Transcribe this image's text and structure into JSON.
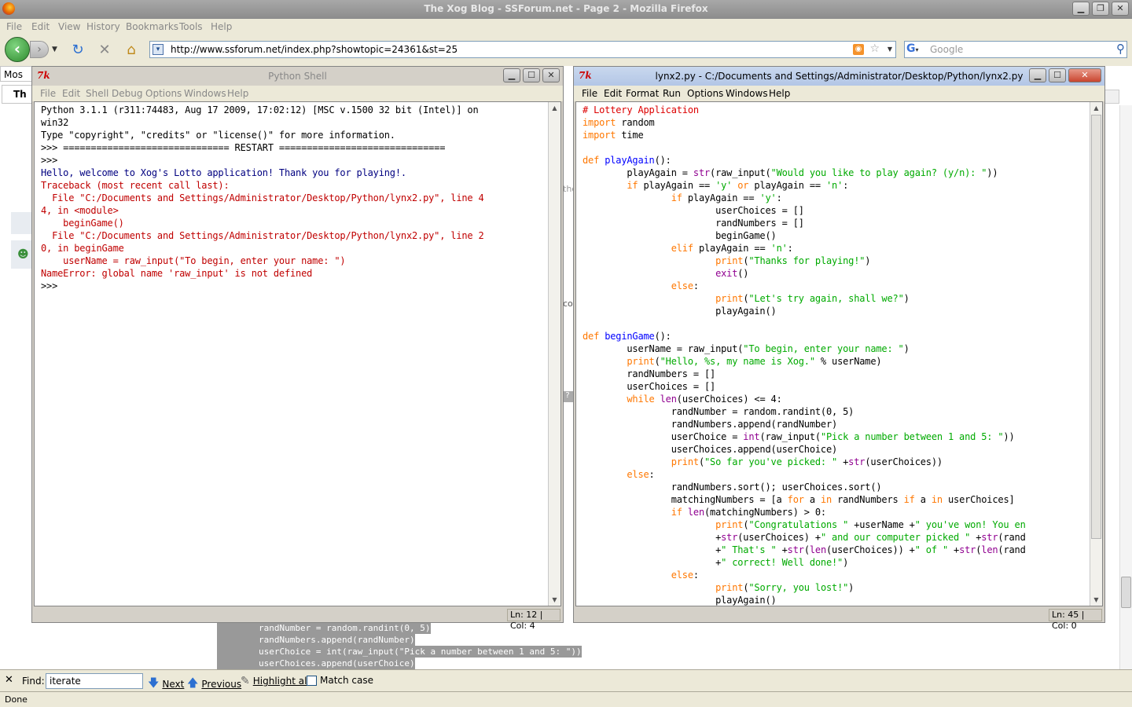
{
  "browser": {
    "title": "The Xog Blog - SSForum.net - Page 2 - Mozilla Firefox",
    "menu": [
      "File",
      "Edit",
      "View",
      "History",
      "Bookmarks",
      "Tools",
      "Help"
    ],
    "url": "http://www.ssforum.net/index.php?showtopic=24361&st=25",
    "search_placeholder": "Google",
    "tab_fragments": [
      "Mos",
      "Th"
    ],
    "status": "Done"
  },
  "find_bar": {
    "label": "Find:",
    "value": "iterate",
    "next": "Next",
    "previous": "Previous",
    "highlight_all": "Highlight all",
    "match_case": "Match case"
  },
  "page_fragments": [
    "the",
    "co",
    "?"
  ],
  "page_code_strip": [
    "        randNumber = random.randint(0, 5)",
    "        randNumbers.append(randNumber)",
    "        userChoice = int(raw_input(\"Pick a number between 1 and 5: \"))",
    "        userChoices.append(userChoice)"
  ],
  "shell": {
    "title": "Python Shell",
    "tk_icon": "7k",
    "menu": [
      "File",
      "Edit",
      "Shell",
      "Debug",
      "Options",
      "Windows",
      "Help"
    ],
    "lines": [
      {
        "cls": "",
        "text": "Python 3.1.1 (r311:74483, Aug 17 2009, 17:02:12) [MSC v.1500 32 bit (Intel)] on"
      },
      {
        "cls": "",
        "text": "win32"
      },
      {
        "cls": "",
        "text": "Type \"copyright\", \"credits\" or \"license()\" for more information."
      },
      {
        "cls": "",
        "text": ">>> ============================== RESTART =============================="
      },
      {
        "cls": "",
        "text": ">>>"
      },
      {
        "cls": "out",
        "text": "Hello, welcome to Xog's Lotto application! Thank you for playing!."
      },
      {
        "cls": "err",
        "text": "Traceback (most recent call last):"
      },
      {
        "cls": "err",
        "text": "  File \"C:/Documents and Settings/Administrator/Desktop/Python/lynx2.py\", line 4"
      },
      {
        "cls": "err",
        "text": "4, in <module>"
      },
      {
        "cls": "err",
        "text": "    beginGame()"
      },
      {
        "cls": "err",
        "text": "  File \"C:/Documents and Settings/Administrator/Desktop/Python/lynx2.py\", line 2"
      },
      {
        "cls": "err",
        "text": "0, in beginGame"
      },
      {
        "cls": "err",
        "text": "    userName = raw_input(\"To begin, enter your name: \")"
      },
      {
        "cls": "err",
        "text": "NameError: global name 'raw_input' is not defined"
      },
      {
        "cls": "",
        "text": ">>>"
      }
    ],
    "status": "Ln: 12 | Col: 4"
  },
  "editor": {
    "title": "lynx2.py - C:/Documents and Settings/Administrator/Desktop/Python/lynx2.py",
    "tk_icon": "7k",
    "menu": [
      "File",
      "Edit",
      "Format",
      "Run",
      "Options",
      "Windows",
      "Help"
    ],
    "lines": [
      [
        [
          "c",
          "# Lottery Application"
        ]
      ],
      [
        [
          "k",
          "import"
        ],
        [
          "",
          " random"
        ]
      ],
      [
        [
          "k",
          "import"
        ],
        [
          "",
          " time"
        ]
      ],
      [
        [
          "",
          ""
        ]
      ],
      [
        [
          "k",
          "def"
        ],
        [
          "",
          " "
        ],
        [
          "d",
          "playAgain"
        ],
        [
          "",
          "():"
        ]
      ],
      [
        [
          "",
          "        playAgain = "
        ],
        [
          "b",
          "str"
        ],
        [
          "",
          "(raw_input("
        ],
        [
          "s",
          "\"Would you like to play again? (y/n): \""
        ],
        [
          "",
          "))"
        ]
      ],
      [
        [
          "",
          "        "
        ],
        [
          "k",
          "if"
        ],
        [
          "",
          " playAgain == "
        ],
        [
          "s",
          "'y'"
        ],
        [
          "",
          " "
        ],
        [
          "k",
          "or"
        ],
        [
          "",
          " playAgain == "
        ],
        [
          "s",
          "'n'"
        ],
        [
          "",
          ":"
        ]
      ],
      [
        [
          "",
          "                "
        ],
        [
          "k",
          "if"
        ],
        [
          "",
          " playAgain == "
        ],
        [
          "s",
          "'y'"
        ],
        [
          "",
          ":"
        ]
      ],
      [
        [
          "",
          "                        userChoices = []"
        ]
      ],
      [
        [
          "",
          "                        randNumbers = []"
        ]
      ],
      [
        [
          "",
          "                        beginGame()"
        ]
      ],
      [
        [
          "",
          "                "
        ],
        [
          "k",
          "elif"
        ],
        [
          "",
          " playAgain == "
        ],
        [
          "s",
          "'n'"
        ],
        [
          "",
          ":"
        ]
      ],
      [
        [
          "",
          "                        "
        ],
        [
          "k",
          "print"
        ],
        [
          "",
          "("
        ],
        [
          "s",
          "\"Thanks for playing!\""
        ],
        [
          "",
          ")"
        ]
      ],
      [
        [
          "",
          "                        "
        ],
        [
          "b",
          "exit"
        ],
        [
          "",
          "()"
        ]
      ],
      [
        [
          "",
          "                "
        ],
        [
          "k",
          "else"
        ],
        [
          "",
          ":"
        ]
      ],
      [
        [
          "",
          "                        "
        ],
        [
          "k",
          "print"
        ],
        [
          "",
          "("
        ],
        [
          "s",
          "\"Let's try again, shall we?\""
        ],
        [
          "",
          ")"
        ]
      ],
      [
        [
          "",
          "                        playAgain()"
        ]
      ],
      [
        [
          "",
          ""
        ]
      ],
      [
        [
          "k",
          "def"
        ],
        [
          "",
          " "
        ],
        [
          "d",
          "beginGame"
        ],
        [
          "",
          "():"
        ]
      ],
      [
        [
          "",
          "        userName = raw_input("
        ],
        [
          "s",
          "\"To begin, enter your name: \""
        ],
        [
          "",
          ")"
        ]
      ],
      [
        [
          "",
          "        "
        ],
        [
          "k",
          "print"
        ],
        [
          "",
          "("
        ],
        [
          "s",
          "\"Hello, %s, my name is Xog.\""
        ],
        [
          "",
          " % userName)"
        ]
      ],
      [
        [
          "",
          "        randNumbers = []"
        ]
      ],
      [
        [
          "",
          "        userChoices = []"
        ]
      ],
      [
        [
          "",
          "        "
        ],
        [
          "k",
          "while"
        ],
        [
          "",
          " "
        ],
        [
          "b",
          "len"
        ],
        [
          "",
          "(userChoices) <= 4:"
        ]
      ],
      [
        [
          "",
          "                randNumber = random.randint(0, 5)"
        ]
      ],
      [
        [
          "",
          "                randNumbers.append(randNumber)"
        ]
      ],
      [
        [
          "",
          "                userChoice = "
        ],
        [
          "b",
          "int"
        ],
        [
          "",
          "(raw_input("
        ],
        [
          "s",
          "\"Pick a number between 1 and 5: \""
        ],
        [
          "",
          "))"
        ]
      ],
      [
        [
          "",
          "                userChoices.append(userChoice)"
        ]
      ],
      [
        [
          "",
          "                "
        ],
        [
          "k",
          "print"
        ],
        [
          "",
          "("
        ],
        [
          "s",
          "\"So far you've picked: \""
        ],
        [
          "",
          " +"
        ],
        [
          "b",
          "str"
        ],
        [
          "",
          "(userChoices))"
        ]
      ],
      [
        [
          "",
          "        "
        ],
        [
          "k",
          "else"
        ],
        [
          "",
          ":"
        ]
      ],
      [
        [
          "",
          "                randNumbers.sort(); userChoices.sort()"
        ]
      ],
      [
        [
          "",
          "                matchingNumbers = [a "
        ],
        [
          "k",
          "for"
        ],
        [
          "",
          " a "
        ],
        [
          "k",
          "in"
        ],
        [
          "",
          " randNumbers "
        ],
        [
          "k",
          "if"
        ],
        [
          "",
          " a "
        ],
        [
          "k",
          "in"
        ],
        [
          "",
          " userChoices]"
        ]
      ],
      [
        [
          "",
          "                "
        ],
        [
          "k",
          "if"
        ],
        [
          "",
          " "
        ],
        [
          "b",
          "len"
        ],
        [
          "",
          "(matchingNumbers) > 0:"
        ]
      ],
      [
        [
          "",
          "                        "
        ],
        [
          "k",
          "print"
        ],
        [
          "",
          "("
        ],
        [
          "s",
          "\"Congratulations \""
        ],
        [
          "",
          " +userName +"
        ],
        [
          "s",
          "\" you've won! You en"
        ]
      ],
      [
        [
          "",
          "                        +"
        ],
        [
          "b",
          "str"
        ],
        [
          "",
          "(userChoices) +"
        ],
        [
          "s",
          "\" and our computer picked \""
        ],
        [
          "",
          " +"
        ],
        [
          "b",
          "str"
        ],
        [
          "",
          "(rand"
        ]
      ],
      [
        [
          "",
          "                        +"
        ],
        [
          "s",
          "\" That's \""
        ],
        [
          "",
          " +"
        ],
        [
          "b",
          "str"
        ],
        [
          "",
          "("
        ],
        [
          "b",
          "len"
        ],
        [
          "",
          "(userChoices)) +"
        ],
        [
          "s",
          "\" of \""
        ],
        [
          "",
          " +"
        ],
        [
          "b",
          "str"
        ],
        [
          "",
          "("
        ],
        [
          "b",
          "len"
        ],
        [
          "",
          "(rand"
        ]
      ],
      [
        [
          "",
          "                        +"
        ],
        [
          "s",
          "\" correct! Well done!\""
        ],
        [
          "",
          ")"
        ]
      ],
      [
        [
          "",
          "                "
        ],
        [
          "k",
          "else"
        ],
        [
          "",
          ":"
        ]
      ],
      [
        [
          "",
          "                        "
        ],
        [
          "k",
          "print"
        ],
        [
          "",
          "("
        ],
        [
          "s",
          "\"Sorry, you lost!\""
        ],
        [
          "",
          ")"
        ]
      ],
      [
        [
          "",
          "                        playAgain()"
        ]
      ]
    ],
    "status": "Ln: 45 | Col: 0"
  }
}
